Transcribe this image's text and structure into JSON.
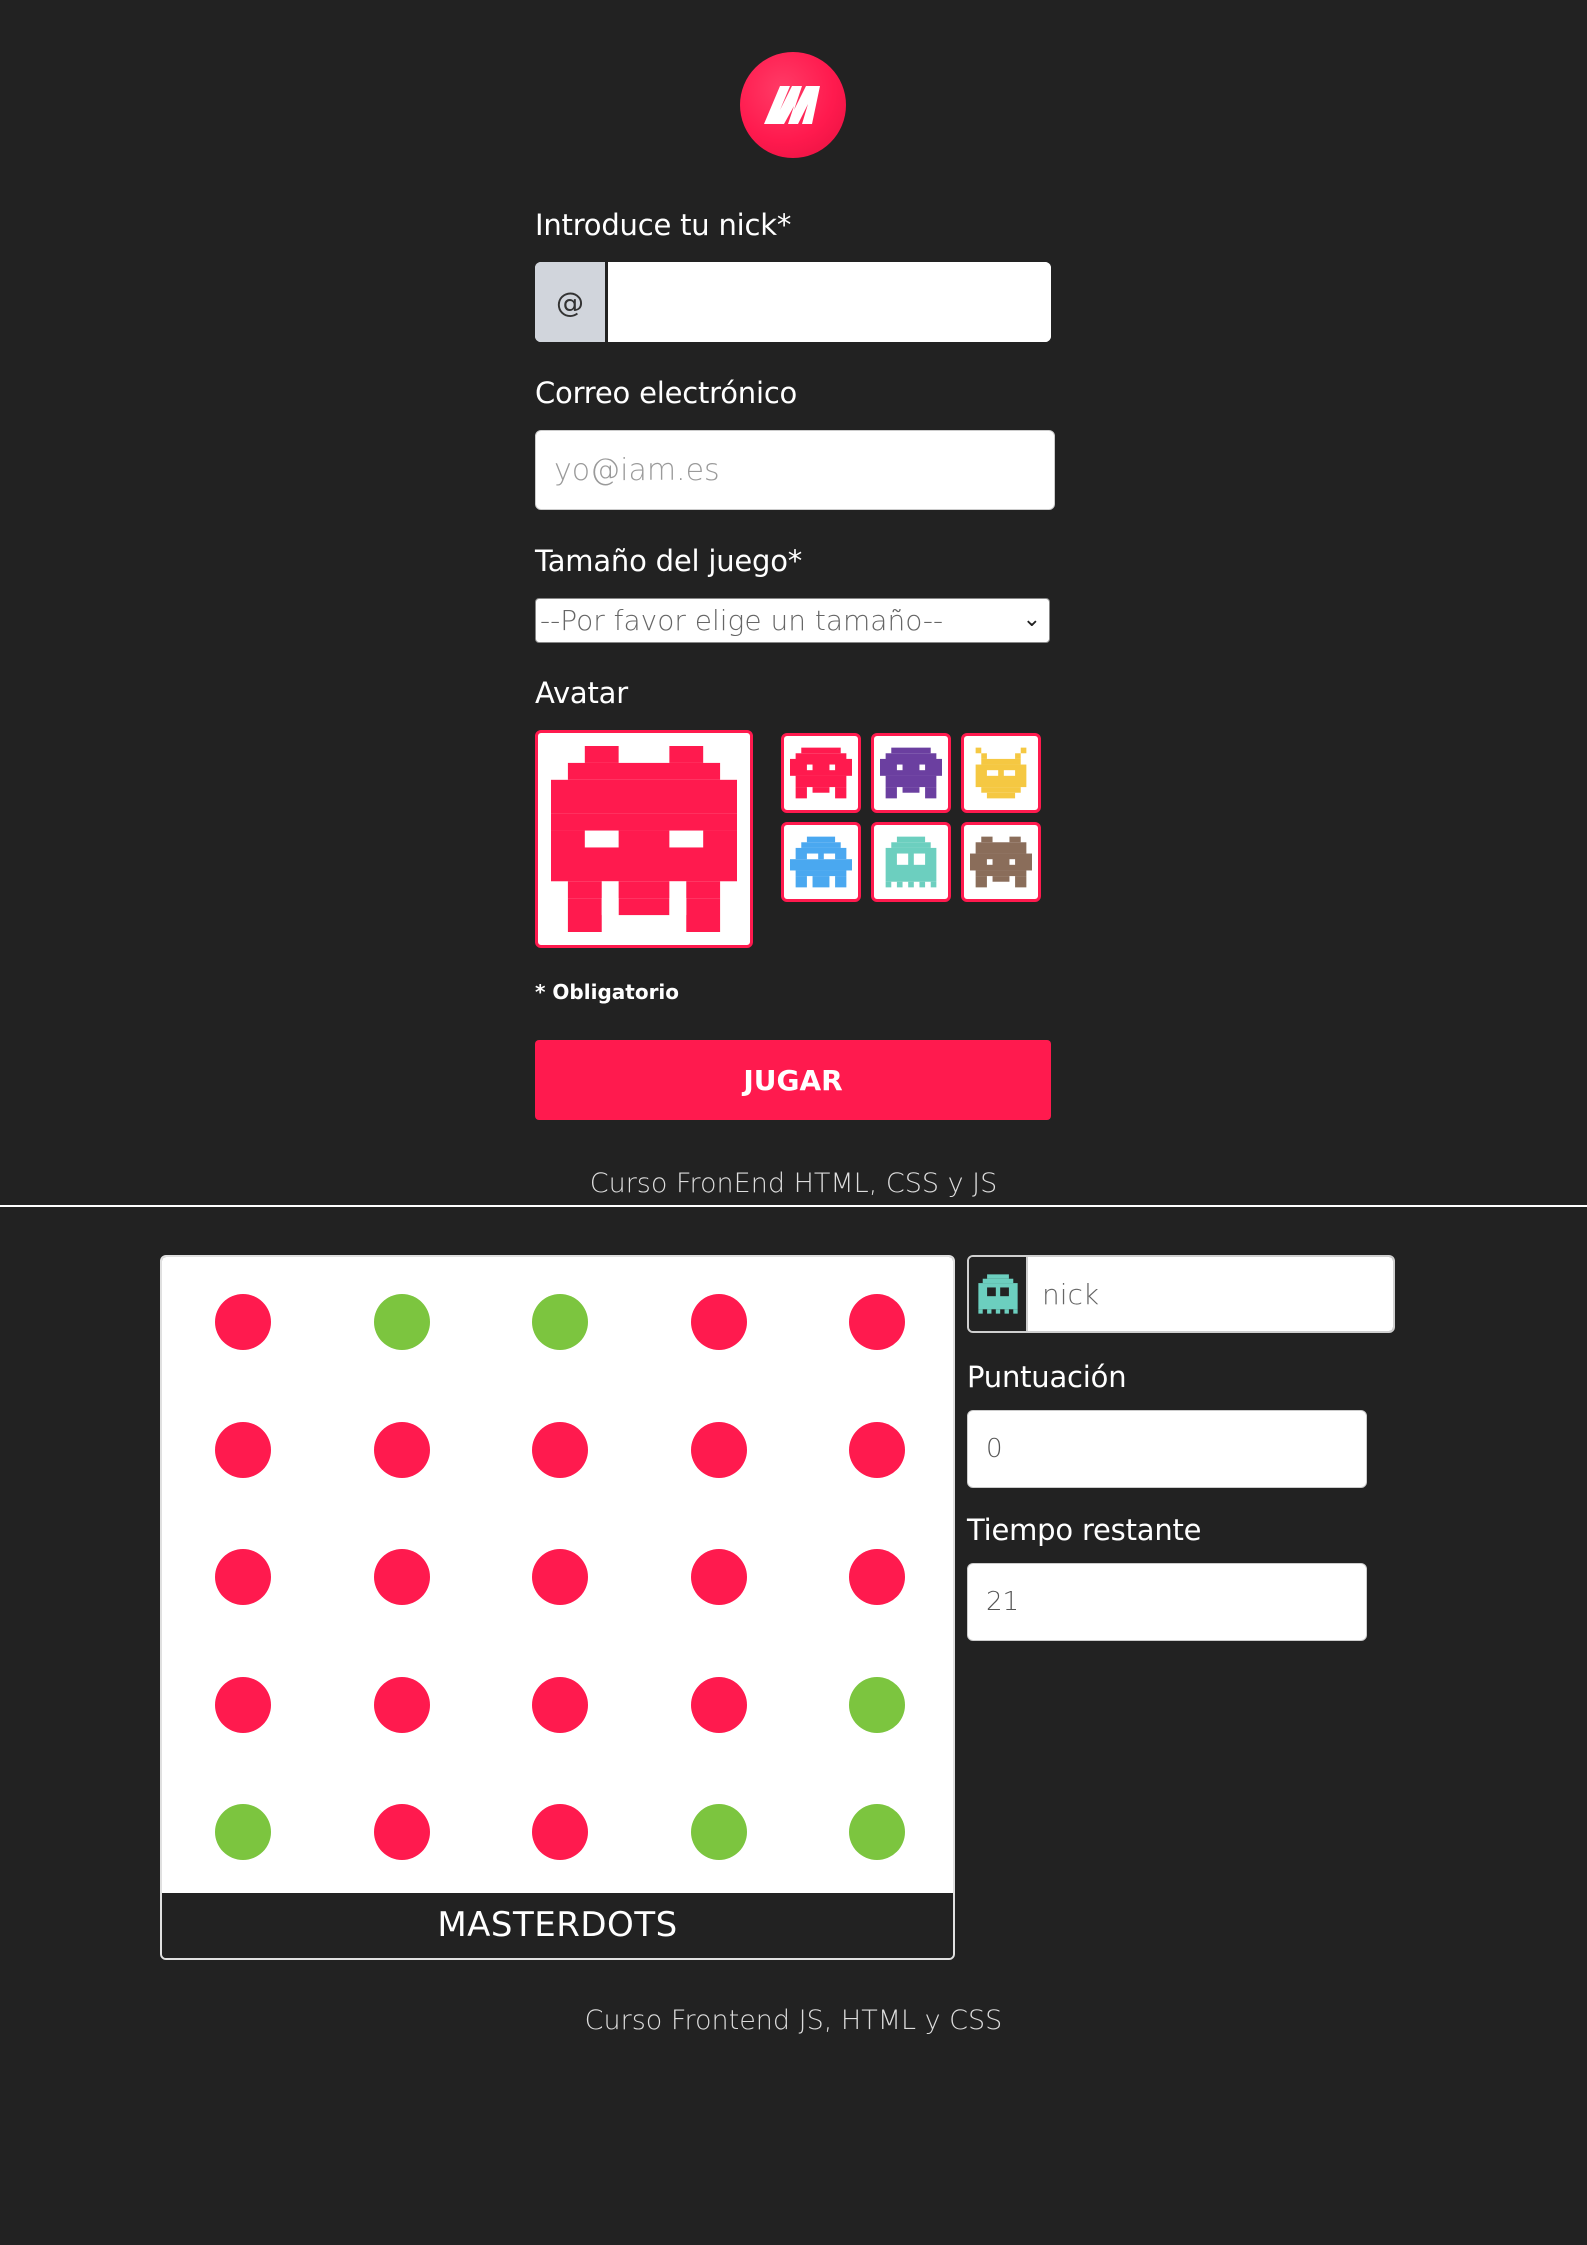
{
  "form": {
    "nick_label": "Introduce tu nick*",
    "nick_addon": "@",
    "nick_value": "",
    "email_label": "Correo electrónico",
    "email_placeholder": "yo@iam.es",
    "size_label": "Tamaño del juego*",
    "size_selected": "--Por favor elige un tamaño--",
    "avatar_label": "Avatar",
    "required_note": "* Obligatorio",
    "play_button": "JUGAR"
  },
  "avatars": {
    "selected": "red-invader",
    "options": [
      {
        "name": "red-invader",
        "color": "#ff1a4e"
      },
      {
        "name": "purple-invader",
        "color": "#6b3fa0"
      },
      {
        "name": "yellow-bug",
        "color": "#f5c842"
      },
      {
        "name": "blue-squid",
        "color": "#4aa8f0"
      },
      {
        "name": "teal-ghost",
        "color": "#6ccfbf"
      },
      {
        "name": "brown-crab",
        "color": "#8a6d5a"
      }
    ]
  },
  "footer_top": "Curso FronEnd HTML, CSS y JS",
  "game": {
    "title": "MASTERDOTS",
    "dots": [
      [
        "red",
        "green",
        "green",
        "red",
        "red"
      ],
      [
        "red",
        "red",
        "red",
        "red",
        "red"
      ],
      [
        "red",
        "red",
        "red",
        "red",
        "red"
      ],
      [
        "red",
        "red",
        "red",
        "red",
        "green"
      ],
      [
        "green",
        "red",
        "red",
        "green",
        "green"
      ]
    ],
    "colors": {
      "red": "#ff1a4e",
      "green": "#7cc53f"
    }
  },
  "player": {
    "nick": "nick",
    "score_label": "Puntuación",
    "score": "0",
    "time_label": "Tiempo restante",
    "time": "21"
  },
  "footer_bottom": "Curso Frontend JS, HTML y CSS",
  "theme": {
    "background": "#222222",
    "accent": "#ff1a4e"
  }
}
